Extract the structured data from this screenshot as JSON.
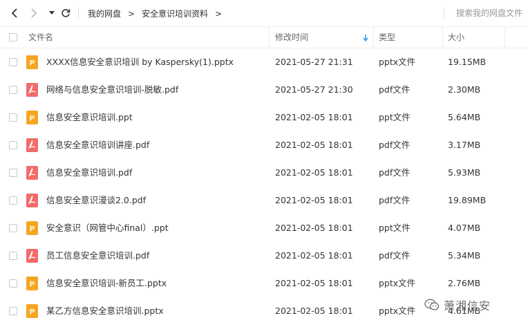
{
  "toolbar": {
    "breadcrumb": [
      "我的网盘",
      "安全意识培训资料"
    ],
    "separator": ">",
    "search_placeholder": "搜索我的网盘文件"
  },
  "columns": {
    "name": "文件名",
    "modified": "修改时间",
    "type": "类型",
    "size": "大小"
  },
  "colors": {
    "pptx_icon": "#F5A623",
    "pdf_icon": "#F26B6B",
    "sort_arrow": "#2E9BE8"
  },
  "files": [
    {
      "name": "XXXX信息安全意识培训 by Kaspersky(1).pptx",
      "modified": "2021-05-27 21:31",
      "type": "pptx文件",
      "size": "19.15MB",
      "icon": "pptx-icon"
    },
    {
      "name": "网络与信息安全意识培训-脱敏.pdf",
      "modified": "2021-05-27 21:30",
      "type": "pdf文件",
      "size": "2.30MB",
      "icon": "pdf-icon"
    },
    {
      "name": "信息安全意识培训.ppt",
      "modified": "2021-02-05 18:01",
      "type": "ppt文件",
      "size": "5.64MB",
      "icon": "pptx-icon"
    },
    {
      "name": "信息安全意识培训讲座.pdf",
      "modified": "2021-02-05 18:01",
      "type": "pdf文件",
      "size": "3.17MB",
      "icon": "pdf-icon"
    },
    {
      "name": "信息安全意识培训.pdf",
      "modified": "2021-02-05 18:01",
      "type": "pdf文件",
      "size": "5.93MB",
      "icon": "pdf-icon"
    },
    {
      "name": "信息安全意识漫谈2.0.pdf",
      "modified": "2021-02-05 18:01",
      "type": "pdf文件",
      "size": "19.89MB",
      "icon": "pdf-icon"
    },
    {
      "name": "安全意识（网管中心final）.ppt",
      "modified": "2021-02-05 18:01",
      "type": "ppt文件",
      "size": "4.07MB",
      "icon": "pptx-icon"
    },
    {
      "name": "员工信息安全意识培训.pdf",
      "modified": "2021-02-05 18:01",
      "type": "pdf文件",
      "size": "5.34MB",
      "icon": "pdf-icon"
    },
    {
      "name": "信息安全意识培训-新员工.pptx",
      "modified": "2021-02-05 18:01",
      "type": "pptx文件",
      "size": "2.76MB",
      "icon": "pptx-icon"
    },
    {
      "name": "某乙方信息安全意识培训.pptx",
      "modified": "2021-02-05 18:01",
      "type": "pptx文件",
      "size": "4.61MB",
      "icon": "pptx-icon"
    }
  ],
  "watermark": {
    "text": "萧湘信安"
  }
}
